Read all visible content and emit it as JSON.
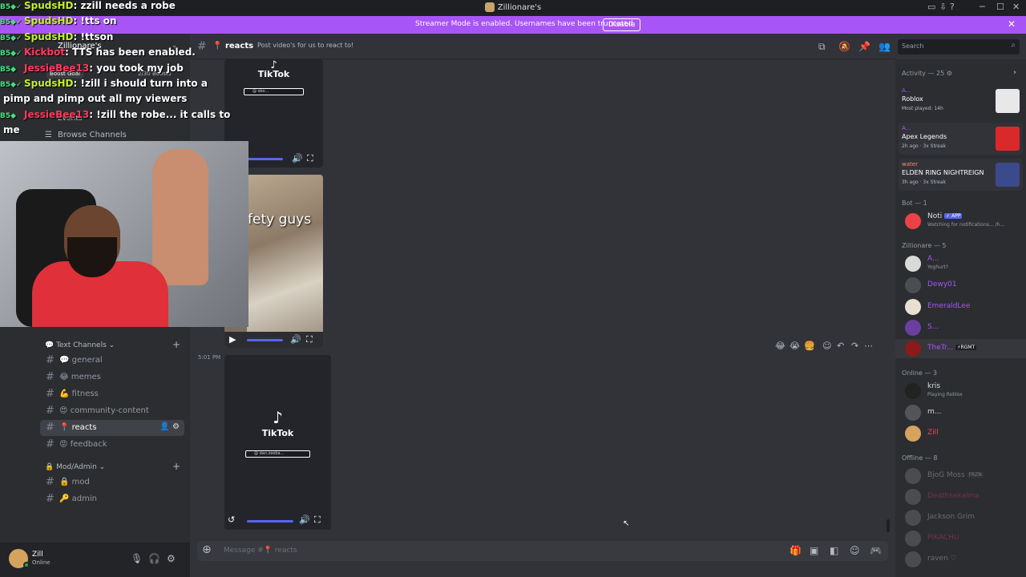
{
  "window": {
    "title": "Zillionare's",
    "minimize": "─",
    "maximize": "☐",
    "close": "✕"
  },
  "banner": {
    "text": "Streamer Mode is enabled. Usernames have been truncated.",
    "button": "Disable"
  },
  "server": {
    "name": "Zillionare's",
    "boost_goal": "Boost Goal",
    "boost_count": "2/30 Boosts",
    "events": "Events",
    "browse_channels": "Browse Channels"
  },
  "categories": [
    {
      "label": "Text Channels",
      "channels": [
        {
          "icon": "💬",
          "name": "general"
        },
        {
          "icon": "😂",
          "name": "memes"
        },
        {
          "icon": "💪",
          "name": "fitness"
        },
        {
          "icon": "😍",
          "name": "community-content"
        },
        {
          "icon": "📍",
          "name": "reacts",
          "active": true
        },
        {
          "icon": "😡",
          "name": "feedback"
        }
      ]
    },
    {
      "label": "Mod/Admin",
      "channels": [
        {
          "icon": "🔒",
          "name": "mod"
        },
        {
          "icon": "🔑",
          "name": "admin"
        }
      ]
    }
  ],
  "user": {
    "name": "Zill",
    "status": "Online"
  },
  "header": {
    "channel": "reacts",
    "topic": "Post video's for us to react to!",
    "search_placeholder": "Search"
  },
  "messages": {
    "timestamp": "5:01 PM",
    "video_caption": "fety guys",
    "tiktok_label": "TikTok",
    "tiktok_handle_1": "@ sbo..."
  },
  "composer": {
    "placeholder": "Message #📍 reacts"
  },
  "members": {
    "activity_header": "Activity — 25",
    "activities": [
      {
        "user": "A...",
        "game": "Roblox",
        "sub": "Most played: 14h"
      },
      {
        "user": "A...",
        "game": "Apex Legends",
        "sub": "2h ago · 3x Streak"
      },
      {
        "user": "water",
        "game": "ELDEN RING NIGHTREIGN",
        "sub": "3h ago · 3x Streak"
      }
    ],
    "bot_header": "Bot — 1",
    "bots": [
      {
        "name": "Noti",
        "badge": "✓ APP",
        "sub": "Watching for notifications... /h..."
      }
    ],
    "role_header": "Zillionare — 5",
    "role_members": [
      {
        "name": "A...",
        "sub": "Yoghurt?",
        "color": "#a855f7"
      },
      {
        "name": "Dewy01",
        "sub": "",
        "color": "#a855f7"
      },
      {
        "name": "EmeraldLee",
        "sub": "",
        "color": "#a855f7"
      },
      {
        "name": "S...",
        "sub": "",
        "color": "#a855f7"
      },
      {
        "name": "TheTr...",
        "sub": "",
        "color": "#a855f7",
        "badge": "⚡RGMT"
      }
    ],
    "online_header": "Online — 3",
    "online_members": [
      {
        "name": "kris",
        "sub": "Playing Roblox",
        "color": "#dbdee1"
      },
      {
        "name": "m...",
        "sub": "",
        "color": "#dbdee1"
      },
      {
        "name": "Zill",
        "sub": "",
        "color": "#ff3b5c"
      }
    ],
    "offline_header": "Offline — 8",
    "offline_members": [
      {
        "name": "BjoG Moss",
        "badge": "FRZN"
      },
      {
        "name": "Deathsekalma"
      },
      {
        "name": "Jackson Grim"
      },
      {
        "name": "PIKACHU"
      },
      {
        "name": "raven ♡"
      }
    ]
  },
  "stream_overlay": {
    "lines": [
      {
        "user": "SpudsHD",
        "text": ": zzill needs a robe",
        "red": false
      },
      {
        "user": "SpudsHD",
        "text": ": !tts on",
        "red": false
      },
      {
        "user": "SpudsHD",
        "text": ": !ttson",
        "red": false
      },
      {
        "user": "Kickbot",
        "text": ": TTS has been enabled.",
        "red": true
      },
      {
        "user": "JessieBee13",
        "text": ": you took my job",
        "red": true
      },
      {
        "user": "SpudsHD",
        "text": ": !zill i should turn into a",
        "red": false
      }
    ],
    "wrap1": "pimp and pimp out all my viewers",
    "line7_user": "JessieBee13",
    "line7_text": ": !zill the robe... it calls to",
    "wrap2": "me"
  },
  "colors": {
    "accent": "#5865f2",
    "banner": "#a855f7",
    "online": "#23a55a"
  }
}
